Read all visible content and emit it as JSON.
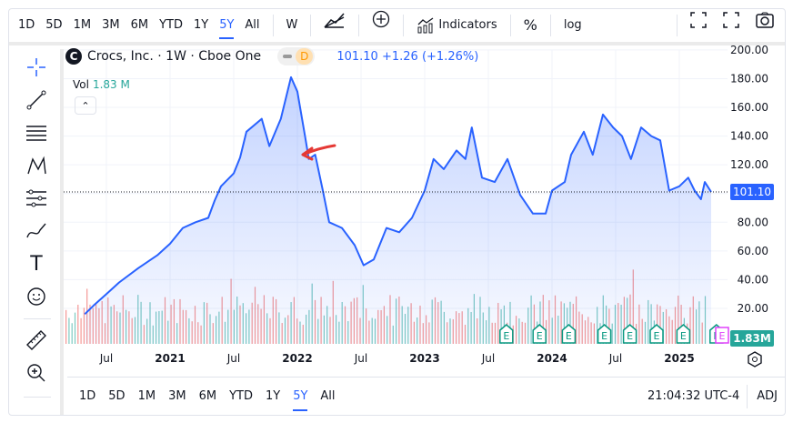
{
  "toolbar": {
    "ranges": [
      "1D",
      "5D",
      "1M",
      "3M",
      "6M",
      "YTD",
      "1Y",
      "5Y",
      "All"
    ],
    "active_range": "5Y",
    "interval": "W",
    "indicators_label": "Indicators",
    "percent_label": "%",
    "log_label": "log"
  },
  "legend": {
    "logo_letter": "C",
    "title": "Crocs, Inc. · 1W · Cboe One",
    "badge": "D",
    "price": "101.10",
    "change": "+1.26",
    "change_pct": "(+1.26%)",
    "vol_label": "Vol",
    "vol_value": "1.83 M"
  },
  "bottom": {
    "ranges": [
      "1D",
      "5D",
      "1M",
      "3M",
      "6M",
      "YTD",
      "1Y",
      "5Y",
      "All"
    ],
    "active_range": "5Y",
    "time": "21:04:32 UTC-4",
    "adj_label": "ADJ"
  },
  "colors": {
    "line": "#2962ff",
    "up": "#26a69a",
    "down": "#ef5350",
    "annotation": "#e53935",
    "earnings": "#089981",
    "next_earnings": "#e040fb"
  },
  "chart_data": {
    "type": "area",
    "ylim": [
      0,
      200
    ],
    "y_ticks": [
      "200.00",
      "180.00",
      "160.00",
      "140.00",
      "120.00",
      "100.00",
      "80.00",
      "60.00",
      "40.00",
      "20.00"
    ],
    "x_ticks": [
      {
        "t": 2020.5,
        "label": "Jul"
      },
      {
        "t": 2021.0,
        "label": "2021"
      },
      {
        "t": 2021.5,
        "label": "Jul"
      },
      {
        "t": 2022.0,
        "label": "2022"
      },
      {
        "t": 2022.5,
        "label": "Jul"
      },
      {
        "t": 2023.0,
        "label": "2023"
      },
      {
        "t": 2023.5,
        "label": "Jul"
      },
      {
        "t": 2024.0,
        "label": "2024"
      },
      {
        "t": 2024.5,
        "label": "Jul"
      },
      {
        "t": 2025.0,
        "label": "2025"
      }
    ],
    "last_price_label": "101.10",
    "volume_label": "1.83M",
    "earnings_label": "E",
    "earnings": [
      2023.67,
      2023.93,
      2024.16,
      2024.44,
      2024.64,
      2024.85,
      2025.06,
      2025.32
    ],
    "next_earnings": 2025.58,
    "series": [
      [
        2020.33,
        16
      ],
      [
        2020.4,
        22
      ],
      [
        2020.5,
        30
      ],
      [
        2020.6,
        38
      ],
      [
        2020.75,
        48
      ],
      [
        2020.9,
        57
      ],
      [
        2021.0,
        65
      ],
      [
        2021.1,
        76
      ],
      [
        2021.2,
        80
      ],
      [
        2021.3,
        83
      ],
      [
        2021.35,
        95
      ],
      [
        2021.4,
        105
      ],
      [
        2021.5,
        114
      ],
      [
        2021.55,
        125
      ],
      [
        2021.6,
        143
      ],
      [
        2021.72,
        152
      ],
      [
        2021.78,
        133
      ],
      [
        2021.87,
        152
      ],
      [
        2021.95,
        181
      ],
      [
        2022.0,
        171
      ],
      [
        2022.06,
        140
      ],
      [
        2022.09,
        124
      ],
      [
        2022.14,
        127
      ],
      [
        2022.2,
        102
      ],
      [
        2022.25,
        80
      ],
      [
        2022.35,
        76
      ],
      [
        2022.45,
        64
      ],
      [
        2022.52,
        50
      ],
      [
        2022.6,
        54
      ],
      [
        2022.7,
        76
      ],
      [
        2022.8,
        73
      ],
      [
        2022.9,
        83
      ],
      [
        2023.0,
        102
      ],
      [
        2023.07,
        124
      ],
      [
        2023.15,
        117
      ],
      [
        2023.25,
        130
      ],
      [
        2023.32,
        124
      ],
      [
        2023.37,
        146
      ],
      [
        2023.45,
        111
      ],
      [
        2023.55,
        108
      ],
      [
        2023.65,
        124
      ],
      [
        2023.75,
        99
      ],
      [
        2023.85,
        86
      ],
      [
        2023.95,
        86
      ],
      [
        2024.0,
        102
      ],
      [
        2024.1,
        108
      ],
      [
        2024.15,
        127
      ],
      [
        2024.25,
        143
      ],
      [
        2024.32,
        127
      ],
      [
        2024.4,
        155
      ],
      [
        2024.48,
        146
      ],
      [
        2024.55,
        140
      ],
      [
        2024.62,
        124
      ],
      [
        2024.7,
        146
      ],
      [
        2024.78,
        140
      ],
      [
        2024.85,
        137
      ],
      [
        2024.92,
        102
      ],
      [
        2025.0,
        105
      ],
      [
        2025.07,
        111
      ],
      [
        2025.12,
        102
      ],
      [
        2025.17,
        96
      ],
      [
        2025.2,
        108
      ],
      [
        2025.25,
        101.1
      ]
    ]
  }
}
